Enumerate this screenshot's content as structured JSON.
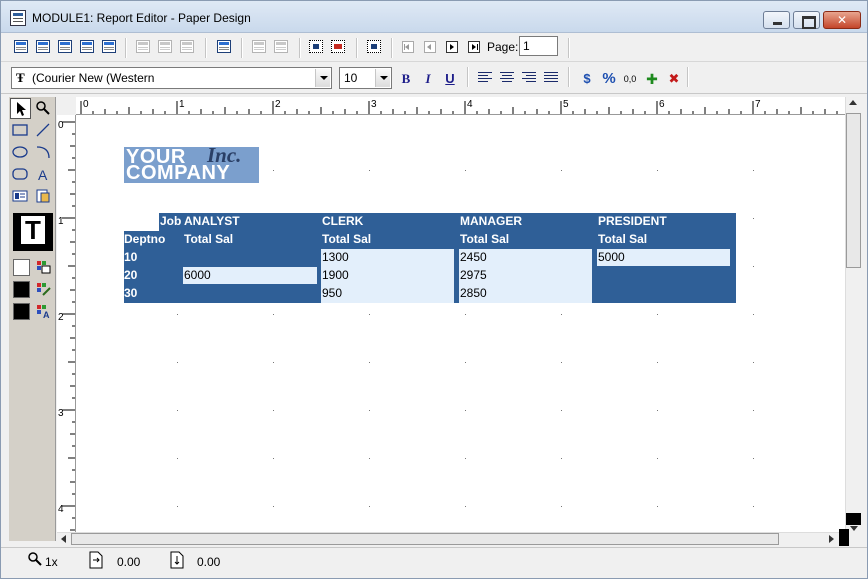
{
  "window": {
    "title": "MODULE1: Report Editor - Paper Design"
  },
  "toolbar": {
    "page_label": "Page:",
    "page_value": "1"
  },
  "format_bar": {
    "font": "(Courier New (Western",
    "size": "10",
    "bold": "B",
    "italic": "I",
    "underline": "U",
    "currency": "$",
    "percent": "%",
    "commas": "0,0",
    "add_decimal": "+.00",
    "remove_decimal": "x.0"
  },
  "ruler": {
    "h_labels": [
      "0",
      "1",
      "2",
      "3",
      "4",
      "5",
      "6",
      "7"
    ],
    "v_labels": [
      "0",
      "1",
      "2",
      "3",
      "4"
    ]
  },
  "report": {
    "logo": {
      "line1": "YOUR",
      "inc": "Inc.",
      "line2": "COMPANY"
    },
    "job_header": "Job",
    "deptno_header": "Deptno",
    "columns": [
      {
        "job": "ANALYST",
        "sub": "Total Sal"
      },
      {
        "job": "CLERK",
        "sub": "Total Sal"
      },
      {
        "job": "MANAGER",
        "sub": "Total Sal"
      },
      {
        "job": "PRESIDENT",
        "sub": "Total Sal"
      }
    ],
    "rows": [
      {
        "deptno": "10",
        "values": [
          "",
          "1300",
          "2450",
          "5000"
        ]
      },
      {
        "deptno": "20",
        "values": [
          "6000",
          "1900",
          "2975",
          ""
        ]
      },
      {
        "deptno": "30",
        "values": [
          "",
          "950",
          "2850",
          ""
        ]
      }
    ]
  },
  "status": {
    "zoom": "1x",
    "x": "0.00",
    "y": "0.00"
  }
}
